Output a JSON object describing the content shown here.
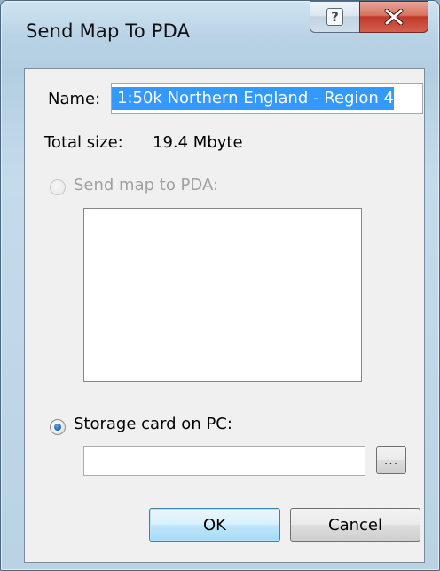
{
  "window": {
    "title": "Send Map To PDA",
    "help_button": "?",
    "close_icon": "close-icon"
  },
  "form": {
    "name_label": "Name:",
    "name_value": "1:50k Northern England - Region 4",
    "total_size_label": "Total size:",
    "total_size_value": "19.4 Mbyte",
    "send_to_pda": {
      "label": "Send map to PDA:",
      "selected": false,
      "enabled": false
    },
    "storage_card": {
      "label": "Storage card on PC:",
      "selected": true,
      "path_value": ""
    },
    "browse_label": "...",
    "ok_label": "OK",
    "cancel_label": "Cancel"
  },
  "colors": {
    "selection": "#3399ff",
    "disabled_text": "#a0a0a0",
    "close_button": "#c0392b"
  }
}
